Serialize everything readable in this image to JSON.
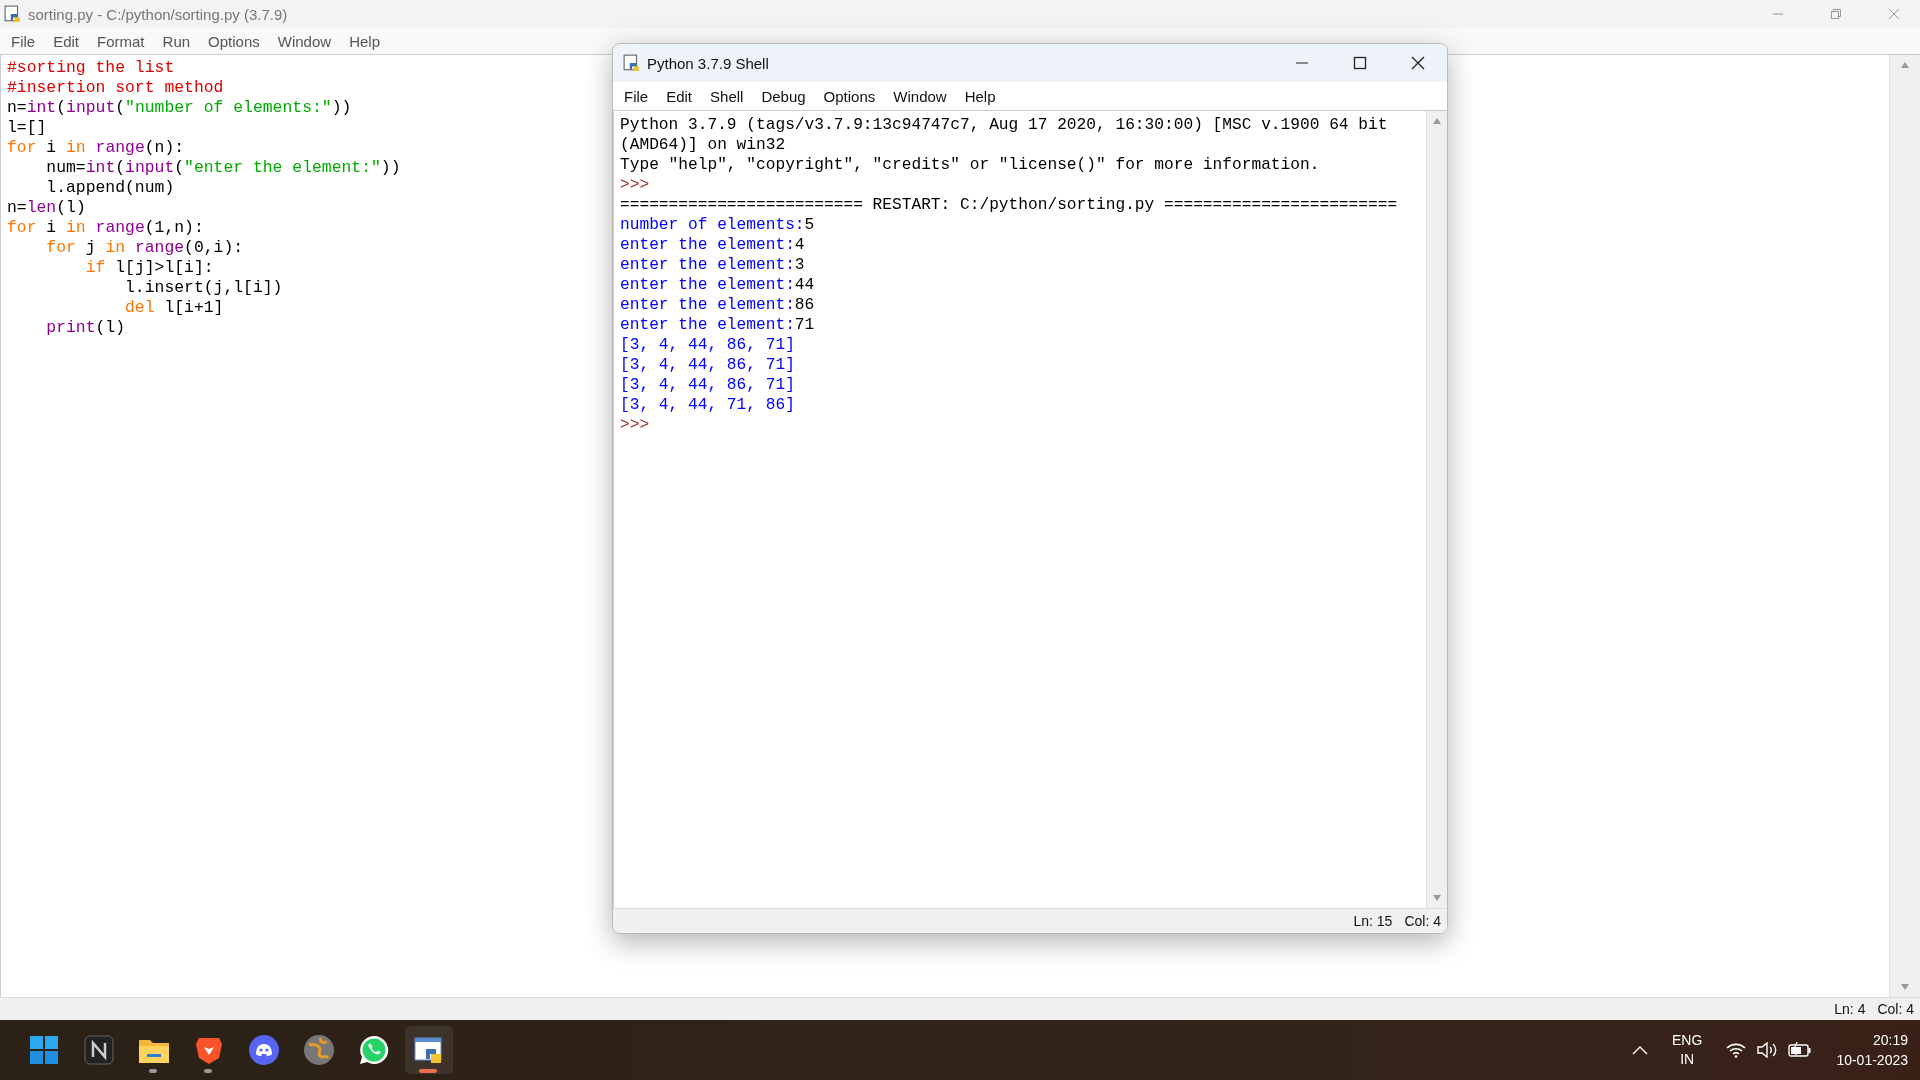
{
  "editor": {
    "title": "sorting.py - C:/python/sorting.py (3.7.9)",
    "menu": [
      "File",
      "Edit",
      "Format",
      "Run",
      "Options",
      "Window",
      "Help"
    ],
    "code_lines": [
      {
        "tokens": [
          {
            "kind": "comment",
            "text": "#sorting the list"
          }
        ]
      },
      {
        "tokens": [
          {
            "kind": "comment",
            "text": "#insertion sort method"
          }
        ]
      },
      {
        "tokens": [
          {
            "kind": "plain",
            "text": "n="
          },
          {
            "kind": "builtin",
            "text": "int"
          },
          {
            "kind": "plain",
            "text": "("
          },
          {
            "kind": "builtin",
            "text": "input"
          },
          {
            "kind": "plain",
            "text": "("
          },
          {
            "kind": "string",
            "text": "\"number of elements:\""
          },
          {
            "kind": "plain",
            "text": "))"
          }
        ]
      },
      {
        "tokens": [
          {
            "kind": "plain",
            "text": "l=[]"
          }
        ]
      },
      {
        "tokens": [
          {
            "kind": "keyword",
            "text": "for"
          },
          {
            "kind": "plain",
            "text": " i "
          },
          {
            "kind": "keyword",
            "text": "in "
          },
          {
            "kind": "builtin",
            "text": "range"
          },
          {
            "kind": "plain",
            "text": "(n):"
          }
        ]
      },
      {
        "tokens": [
          {
            "kind": "plain",
            "text": "    num="
          },
          {
            "kind": "builtin",
            "text": "int"
          },
          {
            "kind": "plain",
            "text": "("
          },
          {
            "kind": "builtin",
            "text": "input"
          },
          {
            "kind": "plain",
            "text": "("
          },
          {
            "kind": "string",
            "text": "\"enter the element:\""
          },
          {
            "kind": "plain",
            "text": "))"
          }
        ]
      },
      {
        "tokens": [
          {
            "kind": "plain",
            "text": "    l.append(num)"
          }
        ]
      },
      {
        "tokens": [
          {
            "kind": "plain",
            "text": "n="
          },
          {
            "kind": "builtin",
            "text": "len"
          },
          {
            "kind": "plain",
            "text": "(l)"
          }
        ]
      },
      {
        "tokens": [
          {
            "kind": "keyword",
            "text": "for"
          },
          {
            "kind": "plain",
            "text": " i "
          },
          {
            "kind": "keyword",
            "text": "in "
          },
          {
            "kind": "builtin",
            "text": "range"
          },
          {
            "kind": "plain",
            "text": "(1,n):"
          }
        ]
      },
      {
        "tokens": [
          {
            "kind": "keyword",
            "text": "    for"
          },
          {
            "kind": "plain",
            "text": " j "
          },
          {
            "kind": "keyword",
            "text": "in "
          },
          {
            "kind": "builtin",
            "text": "range"
          },
          {
            "kind": "plain",
            "text": "(0,i):"
          }
        ]
      },
      {
        "tokens": [
          {
            "kind": "keyword",
            "text": "        if"
          },
          {
            "kind": "plain",
            "text": " l[j]>l[i]:"
          }
        ]
      },
      {
        "tokens": [
          {
            "kind": "plain",
            "text": "            l.insert(j,l[i])"
          }
        ]
      },
      {
        "tokens": [
          {
            "kind": "keyword",
            "text": "            del"
          },
          {
            "kind": "plain",
            "text": " l[i+1]"
          }
        ]
      },
      {
        "tokens": [
          {
            "kind": "builtin",
            "text": "    print"
          },
          {
            "kind": "plain",
            "text": "(l)"
          }
        ]
      }
    ],
    "status": {
      "line": "Ln: 4",
      "col": "Col: 4"
    }
  },
  "shell": {
    "title": "Python 3.7.9 Shell",
    "menu": [
      "File",
      "Edit",
      "Shell",
      "Debug",
      "Options",
      "Window",
      "Help"
    ],
    "lines": [
      {
        "tokens": [
          {
            "kind": "plain",
            "text": "Python 3.7.9 (tags/v3.7.9:13c94747c7, Aug 17 2020, 16:30:00) [MSC v.1900 64 bit"
          }
        ]
      },
      {
        "tokens": [
          {
            "kind": "plain",
            "text": "(AMD64)] on win32"
          }
        ]
      },
      {
        "tokens": [
          {
            "kind": "plain",
            "text": "Type \"help\", \"copyright\", \"credits\" or \"license()\" for more information."
          }
        ]
      },
      {
        "tokens": [
          {
            "kind": "prompt",
            "text": ">>>"
          }
        ]
      },
      {
        "tokens": [
          {
            "kind": "plain",
            "text": "========================= RESTART: C:/python/sorting.py ========================"
          }
        ]
      },
      {
        "tokens": [
          {
            "kind": "stdout",
            "text": "number of elements:"
          },
          {
            "kind": "stdin",
            "text": "5"
          }
        ]
      },
      {
        "tokens": [
          {
            "kind": "stdout",
            "text": "enter the element:"
          },
          {
            "kind": "stdin",
            "text": "4"
          }
        ]
      },
      {
        "tokens": [
          {
            "kind": "stdout",
            "text": "enter the element:"
          },
          {
            "kind": "stdin",
            "text": "3"
          }
        ]
      },
      {
        "tokens": [
          {
            "kind": "stdout",
            "text": "enter the element:"
          },
          {
            "kind": "stdin",
            "text": "44"
          }
        ]
      },
      {
        "tokens": [
          {
            "kind": "stdout",
            "text": "enter the element:"
          },
          {
            "kind": "stdin",
            "text": "86"
          }
        ]
      },
      {
        "tokens": [
          {
            "kind": "stdout",
            "text": "enter the element:"
          },
          {
            "kind": "stdin",
            "text": "71"
          }
        ]
      },
      {
        "tokens": [
          {
            "kind": "stdout",
            "text": "[3, 4, 44, 86, 71]"
          }
        ]
      },
      {
        "tokens": [
          {
            "kind": "stdout",
            "text": "[3, 4, 44, 86, 71]"
          }
        ]
      },
      {
        "tokens": [
          {
            "kind": "stdout",
            "text": "[3, 4, 44, 86, 71]"
          }
        ]
      },
      {
        "tokens": [
          {
            "kind": "stdout",
            "text": "[3, 4, 44, 71, 86]"
          }
        ]
      },
      {
        "tokens": [
          {
            "kind": "prompt",
            "text": ">>>"
          }
        ]
      }
    ],
    "status": {
      "line": "Ln: 15",
      "col": "Col: 4"
    }
  },
  "taskbar": {
    "apps": [
      {
        "kind": "start",
        "running": false,
        "selected": false
      },
      {
        "kind": "notes",
        "running": false,
        "selected": false
      },
      {
        "kind": "folder",
        "running": true,
        "selected": false
      },
      {
        "kind": "lion",
        "running": true,
        "selected": false
      },
      {
        "kind": "chat",
        "running": false,
        "selected": false
      },
      {
        "kind": "globe",
        "running": false,
        "selected": false
      },
      {
        "kind": "phone",
        "running": false,
        "selected": false
      },
      {
        "kind": "idle",
        "running": true,
        "selected": true
      }
    ],
    "tray": {
      "lang": "ENG",
      "region": "IN",
      "time": "20:19",
      "date": "10-01-2023"
    }
  }
}
